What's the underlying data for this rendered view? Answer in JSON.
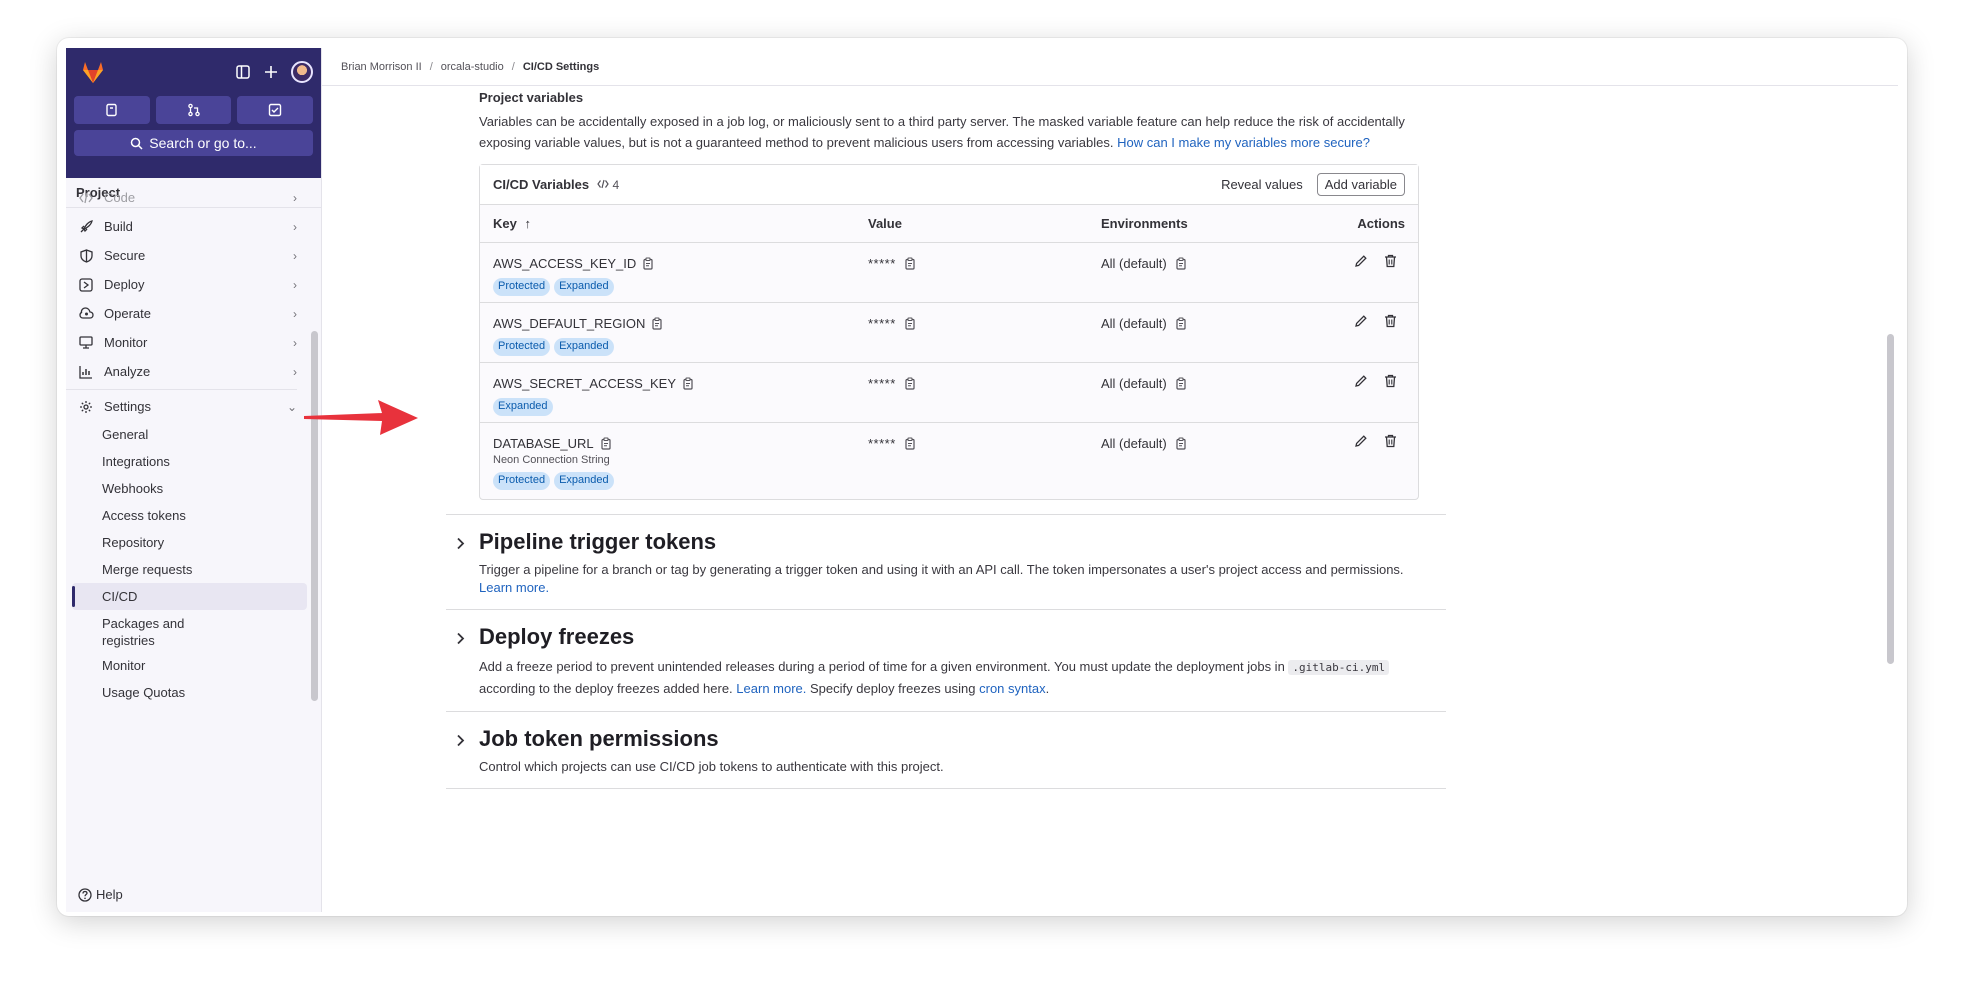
{
  "sidebar": {
    "search_label": "Search or go to...",
    "section_title": "Project",
    "nav": [
      {
        "label": "Code",
        "icon": "code-icon"
      },
      {
        "label": "Build",
        "icon": "rocket-icon"
      },
      {
        "label": "Secure",
        "icon": "shield-icon"
      },
      {
        "label": "Deploy",
        "icon": "deploy-icon"
      },
      {
        "label": "Operate",
        "icon": "cloud-gear-icon"
      },
      {
        "label": "Monitor",
        "icon": "monitor-icon"
      },
      {
        "label": "Analyze",
        "icon": "chart-icon"
      },
      {
        "label": "Settings",
        "icon": "gear-icon"
      }
    ],
    "settings_items": [
      "General",
      "Integrations",
      "Webhooks",
      "Access tokens",
      "Repository",
      "Merge requests",
      "CI/CD",
      "Packages and registries",
      "Monitor",
      "Usage Quotas"
    ],
    "help_label": "Help"
  },
  "breadcrumb": {
    "items": [
      "Brian Morrison II",
      "orcala-studio"
    ],
    "current": "CI/CD Settings"
  },
  "project_variables": {
    "title": "Project variables",
    "description": "Variables can be accidentally exposed in a job log, or maliciously sent to a third party server. The masked variable feature can help reduce the risk of accidentally exposing variable values, but is not a guaranteed method to prevent malicious users from accessing variables.",
    "help_link": "How can I make my variables more secure?",
    "card_title": "CI/CD Variables",
    "count": "4",
    "reveal_label": "Reveal values",
    "add_label": "Add variable",
    "columns": {
      "key": "Key",
      "value": "Value",
      "environments": "Environments",
      "actions": "Actions"
    },
    "rows": [
      {
        "key": "AWS_ACCESS_KEY_ID",
        "note": "",
        "badges": [
          "Protected",
          "Expanded"
        ],
        "value": "*****",
        "env": "All (default)"
      },
      {
        "key": "AWS_DEFAULT_REGION",
        "note": "",
        "badges": [
          "Protected",
          "Expanded"
        ],
        "value": "*****",
        "env": "All (default)"
      },
      {
        "key": "AWS_SECRET_ACCESS_KEY",
        "note": "",
        "badges": [
          "Expanded"
        ],
        "value": "*****",
        "env": "All (default)"
      },
      {
        "key": "DATABASE_URL",
        "note": "Neon Connection String",
        "badges": [
          "Protected",
          "Expanded"
        ],
        "value": "*****",
        "env": "All (default)"
      }
    ]
  },
  "sections": {
    "pipeline": {
      "title": "Pipeline trigger tokens",
      "desc": "Trigger a pipeline for a branch or tag by generating a trigger token and using it with an API call. The token impersonates a user's project access and permissions.",
      "link": "Learn more."
    },
    "freezes": {
      "title": "Deploy freezes",
      "desc_a": "Add a freeze period to prevent unintended releases during a period of time for a given environment. You must update the deployment jobs in",
      "code": ".gitlab-ci.yml",
      "desc_b": "according to the deploy freezes added here.",
      "link1": "Learn more.",
      "desc_c": "Specify deploy freezes using",
      "link2": "cron syntax",
      "desc_d": "."
    },
    "job_token": {
      "title": "Job token permissions",
      "desc": "Control which projects can use CI/CD job tokens to authenticate with this project."
    }
  },
  "colors": {
    "sidebar_top": "#2f2a6b",
    "link": "#1f63bf",
    "badge_bg": "#cbe2f9",
    "arrow": "#e8323c"
  }
}
